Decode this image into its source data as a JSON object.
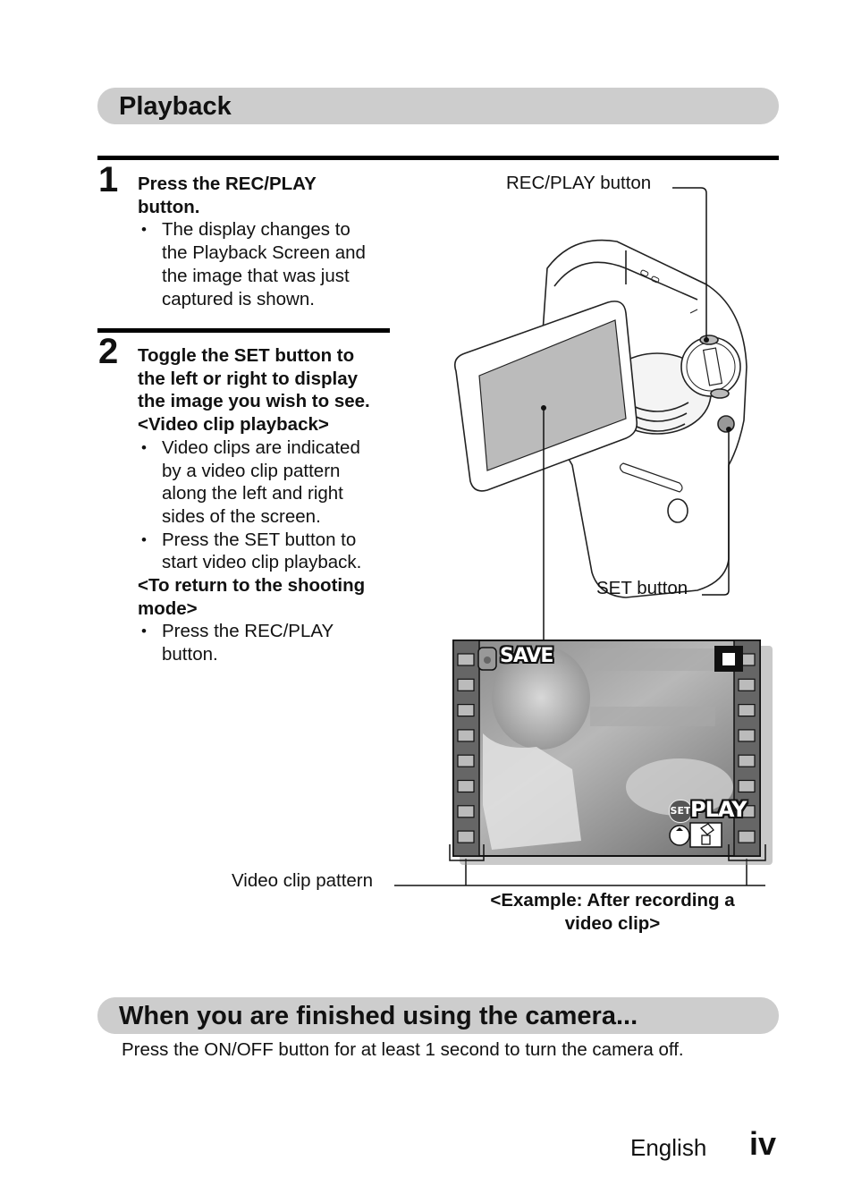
{
  "sections": {
    "playback": {
      "title": "Playback"
    },
    "finished": {
      "title": "When you are finished using the camera...",
      "body": "Press the ON/OFF button for at least 1 second to turn the camera off."
    }
  },
  "steps": [
    {
      "number": "1",
      "heading_lines": [
        "Press the REC/PLAY",
        "button."
      ],
      "bullets": [
        [
          "The display changes to",
          "the Playback Screen and",
          "the image that was just",
          "captured is shown."
        ]
      ]
    },
    {
      "number": "2",
      "heading_lines": [
        "Toggle the SET button to",
        "the left or right to display",
        "the image you wish to see."
      ],
      "sub1_title": "<Video clip playback>",
      "sub1_bullets": [
        [
          "Video clips are indicated",
          "by a video clip pattern",
          "along the left and right",
          "sides of the screen."
        ],
        [
          "Press the SET button to",
          "start video clip playback."
        ]
      ],
      "sub2_title_lines": [
        "<To return to the shooting",
        "mode>"
      ],
      "sub2_bullets": [
        [
          "Press the REC/PLAY",
          "button."
        ]
      ]
    }
  ],
  "illustration": {
    "callouts": {
      "rec_play": "REC/PLAY button",
      "set": "SET button",
      "video_clip_pattern": "Video clip pattern"
    },
    "lcd": {
      "save_label": "SAVE",
      "set_label": "SET",
      "play_label": "PLAY"
    },
    "caption_lines": [
      "<Example: After recording a",
      "video clip>"
    ]
  },
  "footer": {
    "language": "English",
    "page": "iv"
  }
}
